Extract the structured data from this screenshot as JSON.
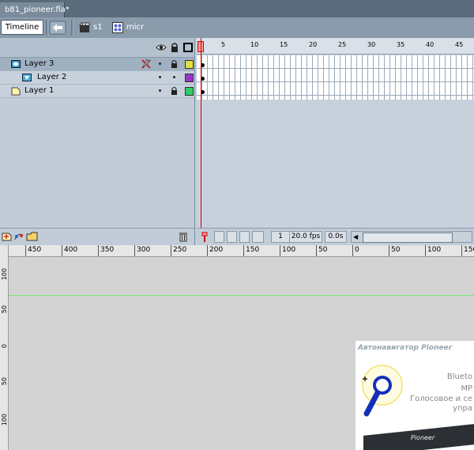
{
  "document": {
    "tab_title": "b81_pioneer.fla*"
  },
  "editbar": {
    "timeline_label": "Timeline",
    "breadcrumbs": [
      {
        "label": "s1",
        "icon": "scene-icon"
      },
      {
        "label": "micr",
        "icon": "movieclip-icon"
      }
    ]
  },
  "timeline": {
    "header_icons": [
      "eye-icon",
      "lock-icon",
      "outline-icon"
    ],
    "layers": [
      {
        "name": "Layer 3",
        "type": "mask-layer-icon",
        "selected": true,
        "color": "#dddd44",
        "hidden_marker": "x-icon"
      },
      {
        "name": "Layer 2",
        "type": "masked-layer-icon",
        "selected": false,
        "color": "#9933cc"
      },
      {
        "name": "Layer 1",
        "type": "normal-layer-icon",
        "selected": false,
        "color": "#33cc66"
      }
    ],
    "frame_numbers": [
      "1",
      "5",
      "10",
      "15",
      "20",
      "25",
      "30",
      "35",
      "40",
      "45"
    ],
    "current_frame": "1",
    "fps": "20.0 fps",
    "elapsed": "0.0s"
  },
  "stage": {
    "hruler_labels": [
      "450",
      "400",
      "350",
      "300",
      "250",
      "200",
      "150",
      "100",
      "50",
      "0",
      "50",
      "100",
      "150"
    ],
    "vruler_labels": [
      "100",
      "50",
      "0",
      "50",
      "100"
    ],
    "guide_color": "#7ee37e",
    "banner": {
      "title": "Автонавигатор Pioneer",
      "lines": [
        "Blueto",
        "MP",
        "Голосовое и се",
        "упра"
      ],
      "brand": "Pioneer"
    }
  }
}
